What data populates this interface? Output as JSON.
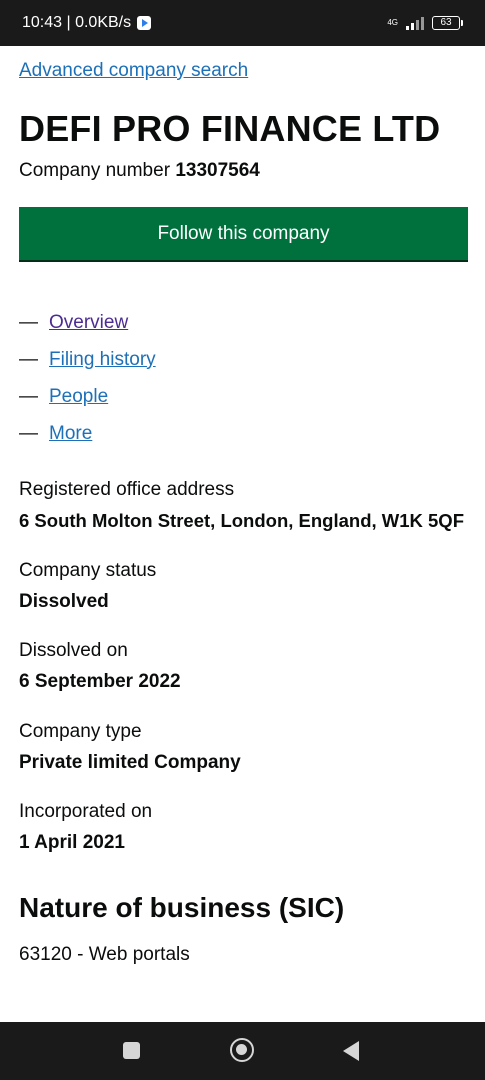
{
  "status_bar": {
    "time_speed": "10:43 | 0.0KB/s",
    "network": "4G",
    "battery": "63"
  },
  "header": {
    "advanced_search_link": "Advanced company search",
    "company_name": "DEFI PRO FINANCE LTD",
    "company_number_label": "Company number",
    "company_number": "13307564",
    "follow_button": "Follow this company"
  },
  "tabs": [
    {
      "label": "Overview"
    },
    {
      "label": "Filing history"
    },
    {
      "label": "People"
    },
    {
      "label": "More"
    }
  ],
  "details": {
    "registered_office": {
      "label": "Registered office address",
      "value": "6 South Molton Street, London, England, W1K 5QF"
    },
    "status": {
      "label": "Company status",
      "value": "Dissolved"
    },
    "dissolved_on": {
      "label": "Dissolved on",
      "value": "6 September 2022"
    },
    "type": {
      "label": "Company type",
      "value": "Private limited Company"
    },
    "incorporated_on": {
      "label": "Incorporated on",
      "value": "1 April 2021"
    }
  },
  "sic": {
    "heading": "Nature of business (SIC)",
    "items": [
      "63120 - Web portals"
    ]
  },
  "colors": {
    "link": "#1d70b8",
    "visited_link": "#4c2c92",
    "button": "#00703c",
    "text": "#0b0c0c"
  }
}
